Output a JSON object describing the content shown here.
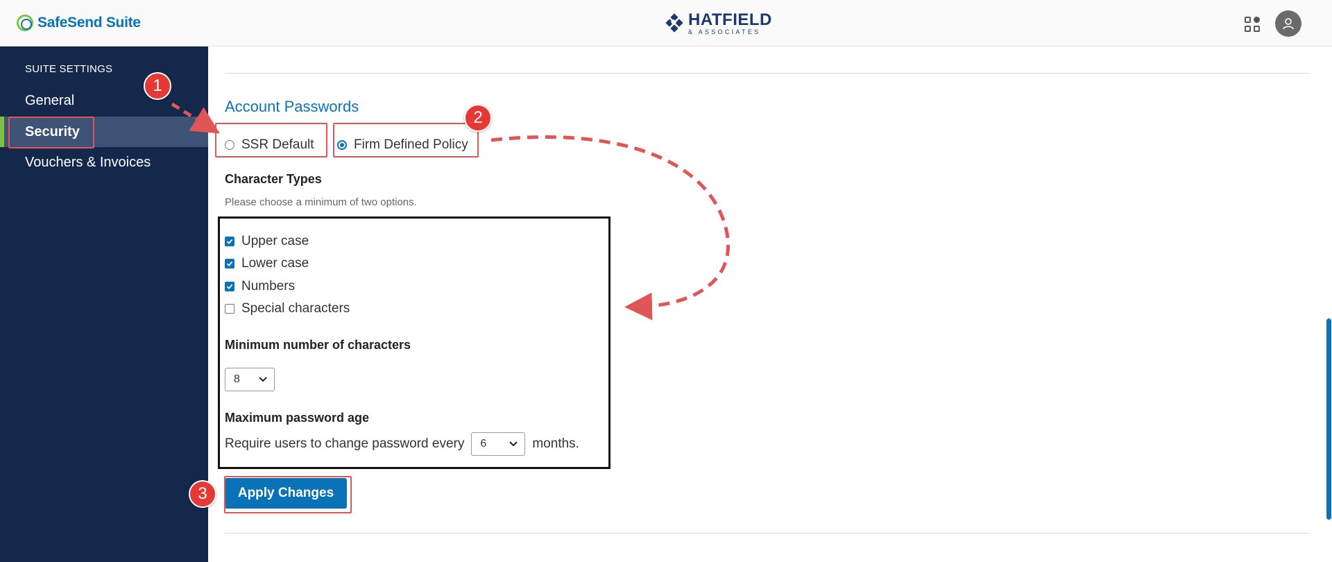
{
  "header": {
    "brand_name": "SafeSend Suite",
    "firm_name": "HATFIELD",
    "firm_sub": "& ASSOCIATES"
  },
  "sidebar": {
    "heading": "SUITE SETTINGS",
    "items": [
      {
        "label": "General"
      },
      {
        "label": "Security"
      },
      {
        "label": "Vouchers & Invoices"
      }
    ]
  },
  "main": {
    "section_title": "Account Passwords",
    "policy": {
      "options": [
        "SSR Default",
        "Firm Defined Policy"
      ],
      "selected": "Firm Defined Policy"
    },
    "character_types": {
      "label": "Character Types",
      "hint": "Please choose a minimum of two options.",
      "options": [
        {
          "label": "Upper case",
          "checked": true
        },
        {
          "label": "Lower case",
          "checked": true
        },
        {
          "label": "Numbers",
          "checked": true
        },
        {
          "label": "Special characters",
          "checked": false
        }
      ]
    },
    "min_chars": {
      "label": "Minimum number of characters",
      "value": "8"
    },
    "max_age": {
      "label": "Maximum password age",
      "prefix": "Require users to change password every",
      "value": "6",
      "suffix": "months."
    },
    "apply_label": "Apply Changes"
  },
  "annotations": {
    "badge_1": "1",
    "badge_2": "2",
    "badge_3": "3",
    "color": "#e53935"
  },
  "colors": {
    "accent": "#0a73b7",
    "sidebar_bg": "#13284b",
    "sidebar_active": "#3e5375",
    "brand_green": "#7cc242"
  }
}
